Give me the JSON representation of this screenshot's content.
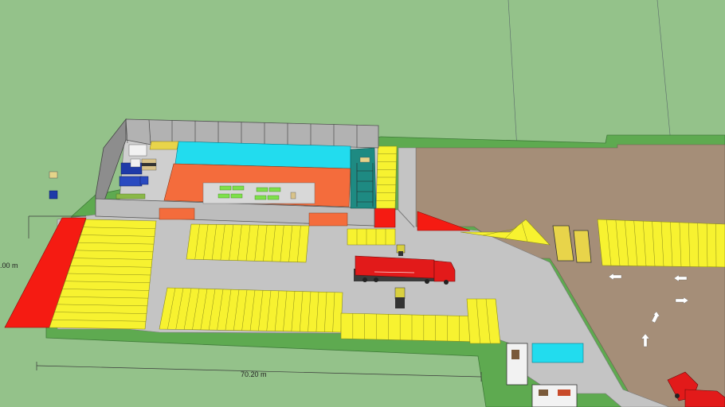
{
  "dimensions": {
    "horizontal_label": "70.20 m",
    "vertical_label": ".00 m"
  },
  "colors": {
    "background": "#94c28a",
    "grass": "#5eaa50",
    "concrete": "#c4c4c4",
    "dirt": "#a58e78",
    "parking_yellow": "#f7f230",
    "hazard_red": "#f51b12",
    "storage_cyan": "#22dcee",
    "floor_orange": "#f46c3c",
    "truck_red": "#e21a1a"
  }
}
